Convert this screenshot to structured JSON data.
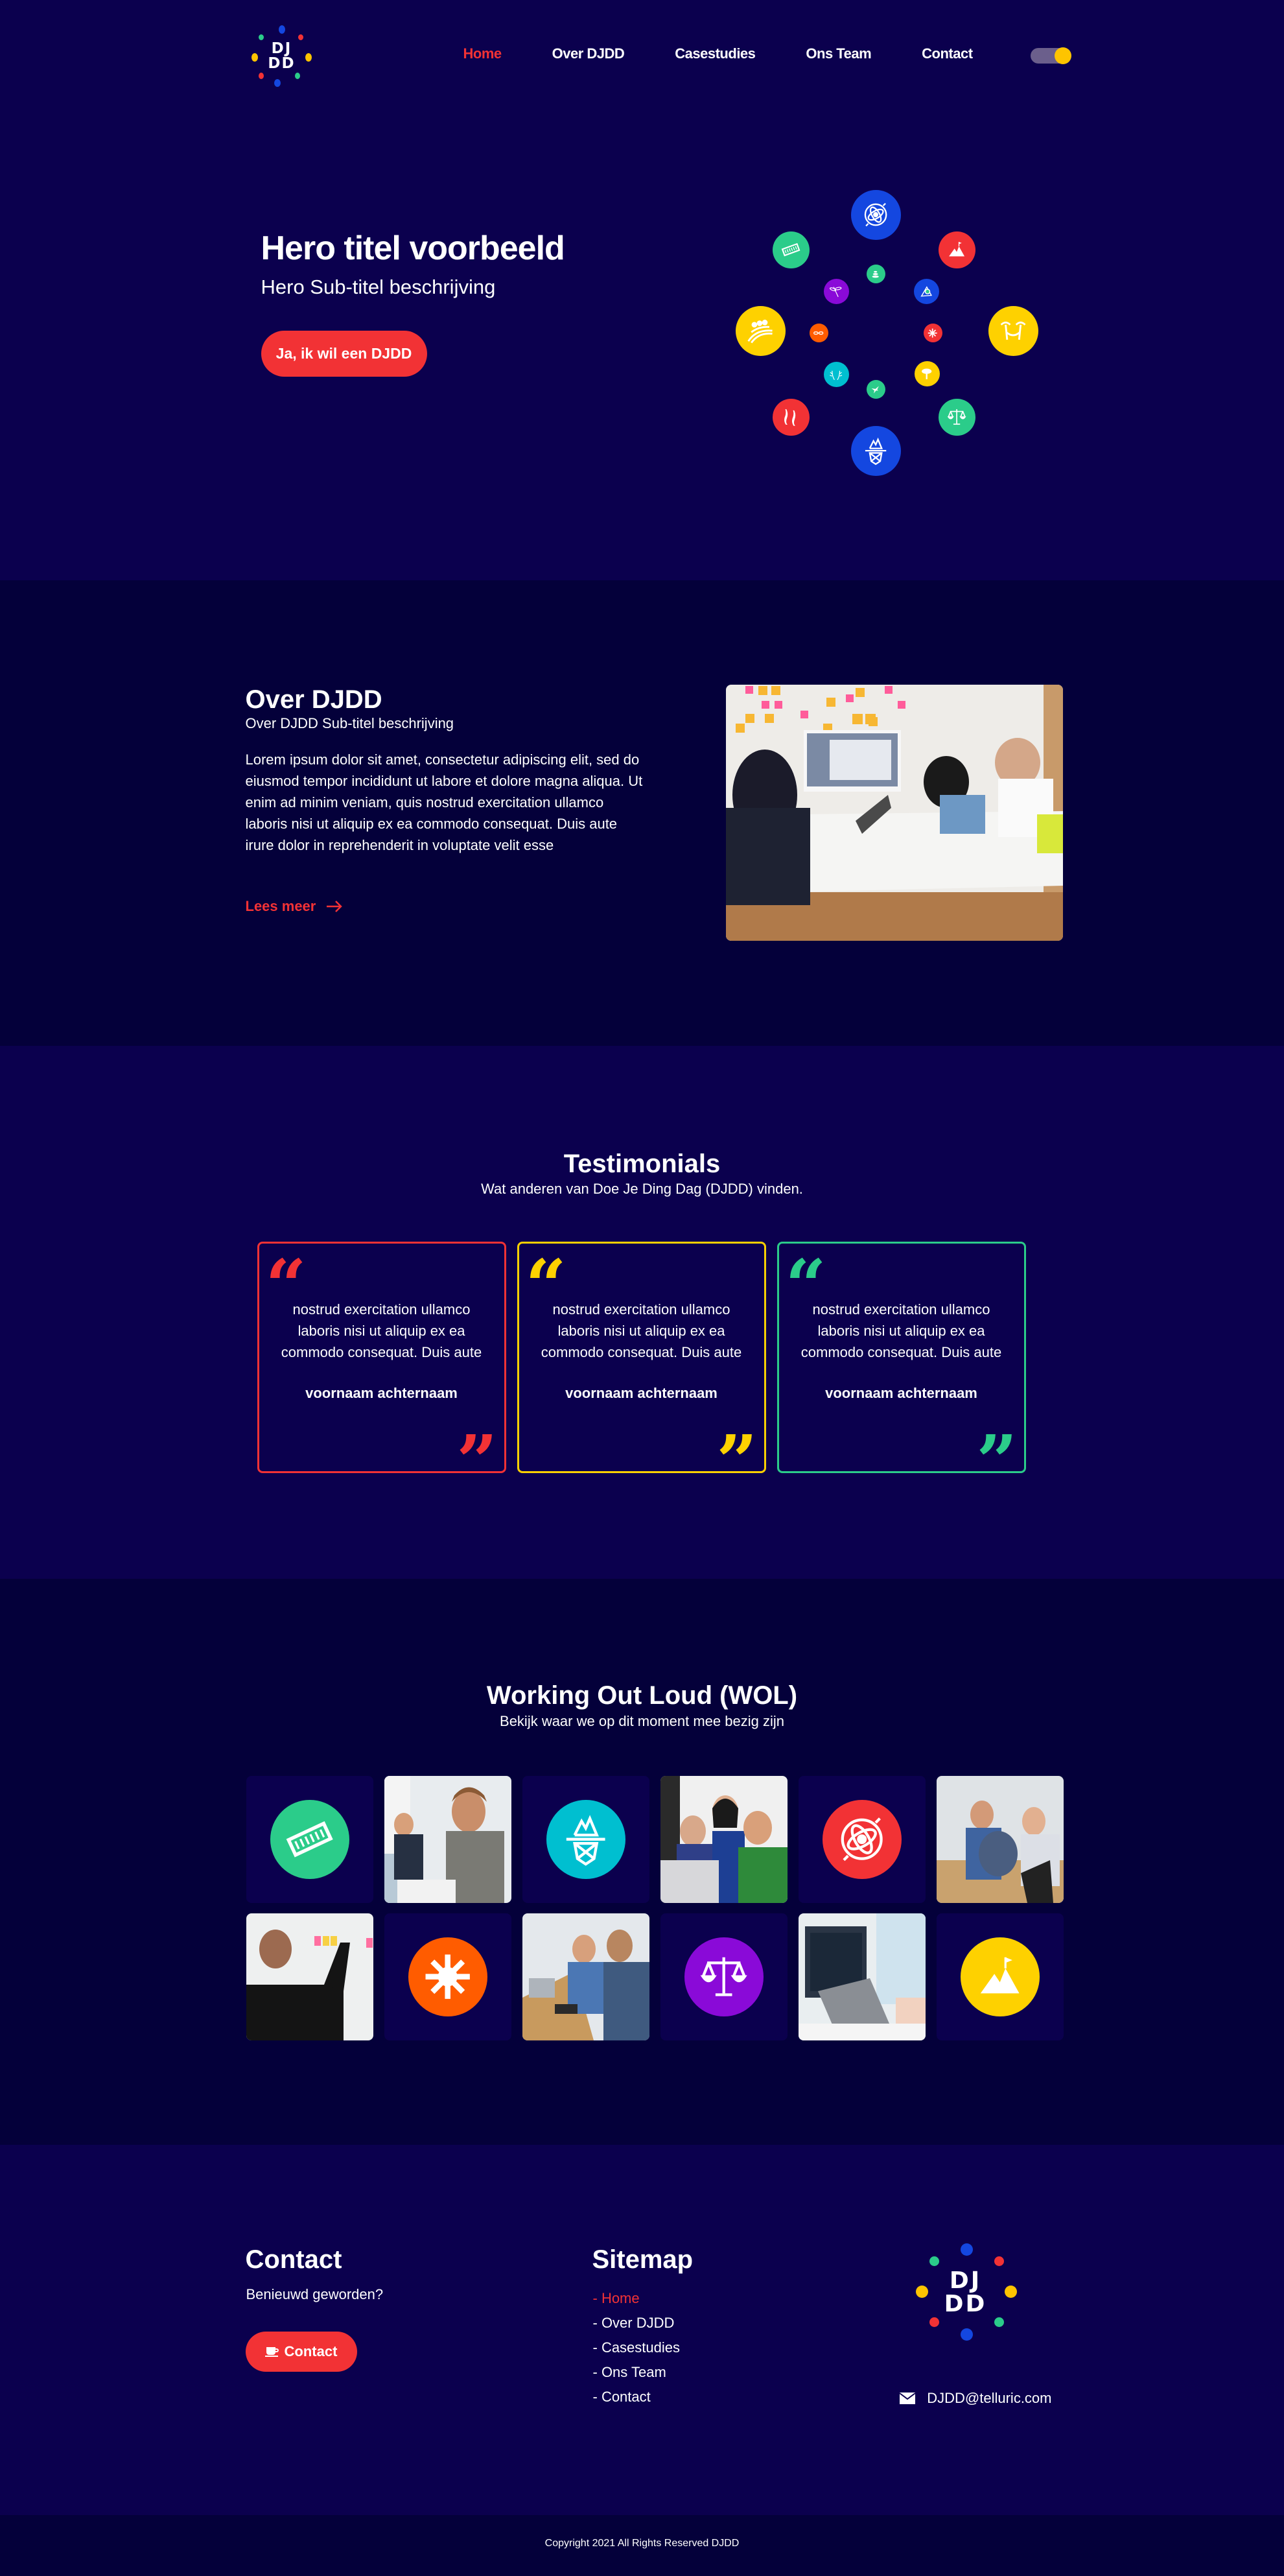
{
  "brand": {
    "logo_text_line1": "DJ",
    "logo_text_line2": "DD",
    "colors": {
      "bg_primary": "#0b004e",
      "bg_secondary": "#04003a",
      "red": "#f23235",
      "yellow": "#fed100",
      "green": "#2bcc8a",
      "blue": "#1447e0",
      "teal": "#00bfd0",
      "purple": "#8a0ad8",
      "orange": "#ff5c00",
      "toggle_track": "#6b5f8c"
    }
  },
  "nav": {
    "items": [
      {
        "label": "Home",
        "active": true
      },
      {
        "label": "Over DJDD",
        "active": false
      },
      {
        "label": "Casestudies",
        "active": false
      },
      {
        "label": "Ons Team",
        "active": false
      },
      {
        "label": "Contact",
        "active": false
      }
    ],
    "theme_toggle": "theme-toggle"
  },
  "hero": {
    "title": "Hero titel voorbeeld",
    "subtitle": "Hero Sub-titel beschrijving",
    "cta_label": "Ja, ik wil een DJDD",
    "icons": [
      {
        "name": "atom-icon",
        "color": "blue"
      },
      {
        "name": "mountain-flag-icon",
        "color": "red"
      },
      {
        "name": "hammock-palms-icon",
        "color": "yellow"
      },
      {
        "name": "scales-icon",
        "color": "green"
      },
      {
        "name": "iceberg-icon",
        "color": "blue"
      },
      {
        "name": "koi-fish-icon",
        "color": "red"
      },
      {
        "name": "rollercoaster-icon",
        "color": "yellow"
      },
      {
        "name": "harmonica-icon",
        "color": "green"
      },
      {
        "name": "stones-icon",
        "color": "green"
      },
      {
        "name": "dragonfly-icon",
        "color": "purple"
      },
      {
        "name": "triangle-eye-icon",
        "color": "blue"
      },
      {
        "name": "chain-icon",
        "color": "orange"
      },
      {
        "name": "sparkle-icon",
        "color": "red"
      },
      {
        "name": "antlers-icon",
        "color": "teal"
      },
      {
        "name": "tree-icon",
        "color": "yellow"
      },
      {
        "name": "hummingbird-icon",
        "color": "green"
      }
    ]
  },
  "about": {
    "title": "Over DJDD",
    "subtitle": "Over DJDD Sub-titel beschrijving",
    "body": "Lorem ipsum dolor sit amet, consectetur adipiscing elit, sed do eiusmod tempor incididunt ut labore et dolore magna aliqua. Ut enim ad minim veniam, quis nostrud exercitation ullamco laboris nisi ut aliquip ex ea commodo consequat. Duis aute irure dolor in reprehenderit in voluptate velit esse",
    "link_label": "Lees meer",
    "image_alt": "team meeting around table with sticky notes"
  },
  "testimonials": {
    "title": "Testimonials",
    "subtitle": "Wat anderen van Doe Je Ding Dag (DJDD) vinden.",
    "items": [
      {
        "quote": "nostrud exercitation ullamco laboris nisi ut aliquip ex ea commodo consequat. Duis aute",
        "author": "voornaam achternaam",
        "color": "#f23235"
      },
      {
        "quote": "nostrud exercitation ullamco laboris nisi ut aliquip ex ea commodo consequat. Duis aute",
        "author": "voornaam achternaam",
        "color": "#fed100"
      },
      {
        "quote": "nostrud exercitation ullamco laboris nisi ut aliquip ex ea commodo consequat. Duis aute",
        "author": "voornaam achternaam",
        "color": "#2bcc8a"
      }
    ]
  },
  "wol": {
    "title": "Working Out Loud (WOL)",
    "subtitle": "Bekijk waar we op dit moment mee bezig zijn",
    "tiles": [
      {
        "type": "icon",
        "icon": "harmonica-icon",
        "color": "#2bcc8a"
      },
      {
        "type": "photo",
        "alt": "two men working at computers"
      },
      {
        "type": "icon",
        "icon": "iceberg-icon",
        "color": "#00bfd0"
      },
      {
        "type": "photo",
        "alt": "three colleagues looking at laptop"
      },
      {
        "type": "icon",
        "icon": "atom-icon",
        "color": "#f23235"
      },
      {
        "type": "photo",
        "alt": "team discussion in office"
      },
      {
        "type": "photo",
        "alt": "man placing sticky notes on wall"
      },
      {
        "type": "icon",
        "icon": "sparkle-icon",
        "color": "#ff5c00"
      },
      {
        "type": "photo",
        "alt": "two men talking at desks"
      },
      {
        "type": "icon",
        "icon": "scales-icon",
        "color": "#8a0ad8"
      },
      {
        "type": "photo",
        "alt": "laptop with code on stand"
      },
      {
        "type": "icon",
        "icon": "mountain-flag-icon",
        "color": "#fed100"
      }
    ]
  },
  "footer": {
    "contact_title": "Contact",
    "contact_text": "Benieuwd geworden?",
    "contact_button": "Contact",
    "sitemap_title": "Sitemap",
    "sitemap": [
      {
        "label": "- Home",
        "active": true
      },
      {
        "label": "- Over DJDD",
        "active": false
      },
      {
        "label": "- Casestudies",
        "active": false
      },
      {
        "label": "- Ons Team",
        "active": false
      },
      {
        "label": "- Contact",
        "active": false
      }
    ],
    "email": "DJDD@telluric.com",
    "copyright": "Copyright 2021 All Rights Reserved DJDD"
  }
}
